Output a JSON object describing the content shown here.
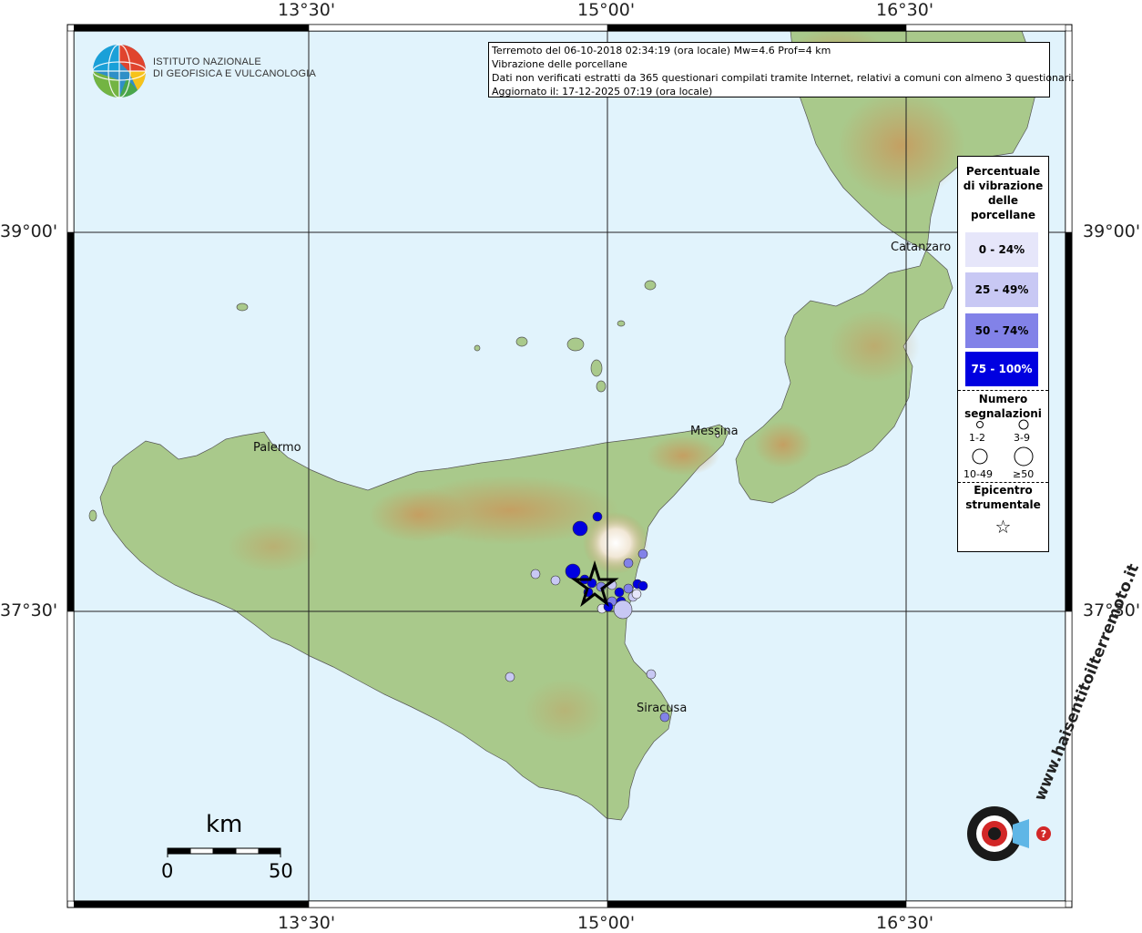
{
  "header": {
    "line1": "Terremoto del 06-10-2018 02:34:19 (ora locale) Mw=4.6 Prof=4 km",
    "line2": "Vibrazione delle porcellane",
    "line3": "Dati non verificati estratti da 365 questionari compilati tramite Internet, relativi a comuni con almeno 3 questionari.",
    "line4": "Aggiornato il: 17-12-2025 07:19 (ora locale)"
  },
  "institute": {
    "line1": "ISTITUTO NAZIONALE",
    "line2": "DI GEOFISICA E VULCANOLOGIA"
  },
  "coords": {
    "lon_13_30": "13°30'",
    "lon_15_00": "15°00'",
    "lon_16_30": "16°30'",
    "lat_39_00": "39°00'",
    "lat_37_30": "37°30'"
  },
  "cities": {
    "palermo": "Palermo",
    "messina": "Messina",
    "catanzaro": "Catanzaro",
    "siracusa": "Siracusa"
  },
  "legend": {
    "title1": "Percentuale",
    "title2": "di vibrazione",
    "title3": "delle",
    "title4": "porcellane",
    "ranges": [
      {
        "label": "0 - 24%",
        "color": "#e6e6fa"
      },
      {
        "label": "25 - 49%",
        "color": "#c8c8f4"
      },
      {
        "label": "50 - 74%",
        "color": "#8282e8"
      },
      {
        "label": "75 - 100%",
        "color": "#0000e0"
      }
    ],
    "count_title1": "Numero",
    "count_title2": "segnalazioni",
    "count_a": "1-2",
    "count_b": "3-9",
    "count_c": "10-49",
    "count_d": "≥50",
    "epi_title1": "Epicentro",
    "epi_title2": "strumentale",
    "epi_symbol": "☆"
  },
  "scale": {
    "unit": "km",
    "start": "0",
    "end": "50"
  },
  "watermark": "www.haisentitoilterremoto.it",
  "colors": {
    "sea": "#e1f3fc",
    "land": "#a8c98a",
    "mountain": "#c9a36a",
    "epicenter": "#000000"
  },
  "observations": [
    {
      "pct_class": 3,
      "count_class": 1
    },
    {
      "pct_class": 3,
      "count_class": 2
    },
    {
      "pct_class": 2,
      "count_class": 1
    },
    {
      "pct_class": 1,
      "count_class": 1
    },
    {
      "pct_class": 3,
      "count_class": 2
    },
    {
      "pct_class": 2,
      "count_class": 1
    },
    {
      "pct_class": 1,
      "count_class": 3
    },
    {
      "pct_class": 0,
      "count_class": 1
    },
    {
      "pct_class": 1,
      "count_class": 1
    },
    {
      "pct_class": 0,
      "count_class": 1
    },
    {
      "pct_class": 2,
      "count_class": 1
    },
    {
      "pct_class": 1,
      "count_class": 1
    },
    {
      "pct_class": 3,
      "count_class": 1
    },
    {
      "pct_class": 1,
      "count_class": 1
    }
  ]
}
